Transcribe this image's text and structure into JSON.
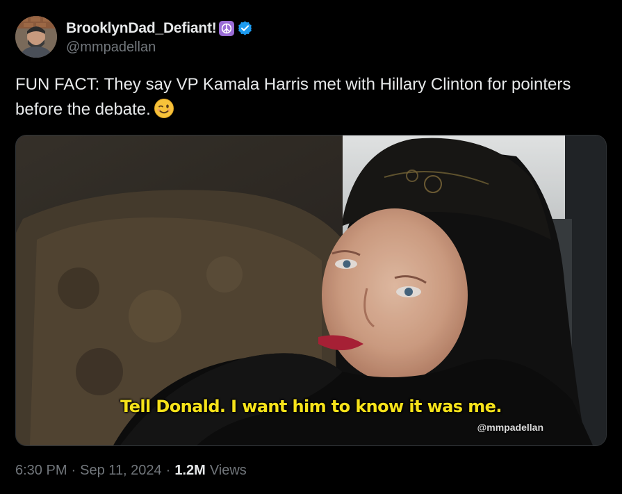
{
  "author": {
    "display_name": "BrooklynDad_Defiant!",
    "handle": "@mmpadellan",
    "badges": [
      "peace-symbol-icon",
      "verified-icon"
    ]
  },
  "tweet": {
    "text": "FUN FACT: They say VP Kamala Harris met with Hillary Clinton for pointers before the debate.",
    "emoji": "winking-face-icon"
  },
  "media": {
    "caption": "Tell Donald. I want him to know it was me.",
    "watermark": "@mmpadellan"
  },
  "meta": {
    "time": "6:30 PM",
    "separator": "·",
    "date": "Sep 11, 2024",
    "views_count": "1.2M",
    "views_label": "Views"
  },
  "colors": {
    "background": "#000000",
    "primary_text": "#e7e9ea",
    "secondary_text": "#71767b",
    "verified_blue": "#1d9bf0",
    "peace_badge": "#9a6cd6",
    "caption_yellow": "#f6e21a"
  }
}
